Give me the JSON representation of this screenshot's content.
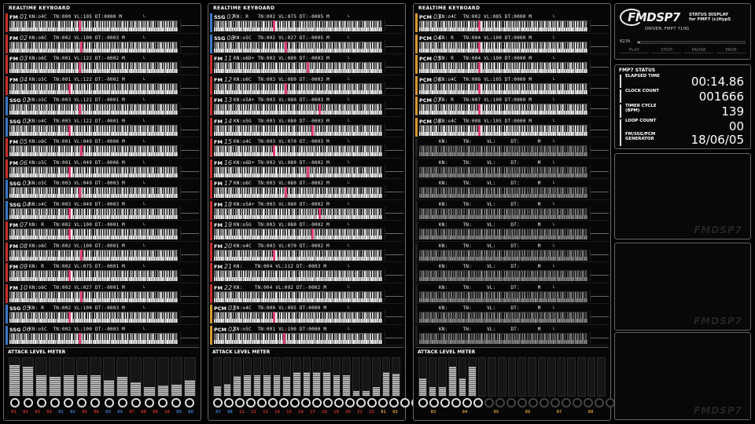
{
  "colors": {
    "fm": "#c8302c",
    "ssg": "#3a78c8",
    "pcm": "#d89830",
    "hit": "#e04070"
  },
  "panel_title": "REALTIME KEYBOARD",
  "meter_title": "ATTACK LEVEL METER",
  "scale_mark": "L",
  "panels": [
    {
      "tracks": [
        {
          "type": "fm",
          "label": "FM",
          "num": "01",
          "info": "KN:o4C  TN:000 VL:105 DT:0000 M",
          "hit": 0.41
        },
        {
          "type": "fm",
          "label": "FM",
          "num": "02",
          "info": "KN:o6C  TN:002 VL:100 DT:-0003 M",
          "hit": 0.42
        },
        {
          "type": "fm",
          "label": "FM",
          "num": "03",
          "info": "KN:o6C  TN:001 VL:122 DT:-0002 M",
          "hit": 0.41
        },
        {
          "type": "fm",
          "label": "FM",
          "num": "04",
          "info": "KN:o5C  TN:001 VL:122 DT:-0002 M",
          "hit": 0.35
        },
        {
          "type": "ssg",
          "label": "SSG",
          "num": "01",
          "info": "KN:o5C  TN:003 VL:122 DT:-0001 M",
          "hit": 0.41
        },
        {
          "type": "ssg",
          "label": "SSG",
          "num": "02",
          "info": "KN:o4C  TN:003 VL:122 DT:-0001 M",
          "hit": 0.35
        },
        {
          "type": "fm",
          "label": "FM",
          "num": "05",
          "info": "KN:o6C  TN:001 VL:049 DT:-0006 M",
          "hit": 0.42
        },
        {
          "type": "fm",
          "label": "FM",
          "num": "06",
          "info": "KN:o5C  TN:001 VL:049 DT:-0006 M",
          "hit": 0.35
        },
        {
          "type": "ssg",
          "label": "SSG",
          "num": "03",
          "info": "KN:o5C  TN:003 VL:049 DT:-0003 M",
          "hit": 0.41
        },
        {
          "type": "ssg",
          "label": "SSG",
          "num": "04",
          "info": "KN:o4C  TN:003 VL:049 DT:-0003 M",
          "hit": 0.35
        },
        {
          "type": "fm",
          "label": "FM",
          "num": "07",
          "info": "KN: R   TN:002 VL:100 DT:-0001 M",
          "hit": 0.35
        },
        {
          "type": "fm",
          "label": "FM",
          "num": "08",
          "info": "KN:o6C  TN:002 VL:100 DT:-0001 M",
          "hit": 0.42
        },
        {
          "type": "fm",
          "label": "FM",
          "num": "09",
          "info": "KN: R   TN:002 VL:075 DT:-0001 M",
          "hit": 0.35
        },
        {
          "type": "fm",
          "label": "FM",
          "num": "10",
          "info": "KN:o6C  TN:002 VL:027 DT:-0001 M",
          "hit": 0.42
        },
        {
          "type": "ssg",
          "label": "SSG",
          "num": "05",
          "info": "KN: R   TN:002 VL:100 DT:-0003 M",
          "hit": 0.35
        },
        {
          "type": "ssg",
          "label": "SSG",
          "num": "06",
          "info": "KN:o5C  TN:002 VL:100 DT:-0003 M",
          "hit": 0.41
        }
      ],
      "meter": {
        "levels": [
          0.82,
          0.78,
          0.55,
          0.5,
          0.55,
          0.55,
          0.55,
          0.42,
          0.5,
          0.35,
          0.22,
          0.28,
          0.3,
          0.42
        ],
        "labels": [
          {
            "c": "fm",
            "t": "01"
          },
          {
            "c": "fm",
            "t": "02"
          },
          {
            "c": "fm",
            "t": "03"
          },
          {
            "c": "fm",
            "t": "04"
          },
          {
            "c": "ssg",
            "t": "01"
          },
          {
            "c": "ssg",
            "t": "02"
          },
          {
            "c": "fm",
            "t": "05"
          },
          {
            "c": "fm",
            "t": "06"
          },
          {
            "c": "ssg",
            "t": "03"
          },
          {
            "c": "ssg",
            "t": "04"
          },
          {
            "c": "fm",
            "t": "07"
          },
          {
            "c": "fm",
            "t": "08"
          },
          {
            "c": "fm",
            "t": "09"
          },
          {
            "c": "fm",
            "t": "10"
          },
          {
            "c": "ssg",
            "t": "05"
          },
          {
            "c": "ssg",
            "t": "06"
          }
        ]
      }
    },
    {
      "tracks": [
        {
          "type": "ssg",
          "label": "SSG",
          "num": "07",
          "info": "KN: R   TN:002 VL:075 DT:-0005 M",
          "hit": 0.35
        },
        {
          "type": "ssg",
          "label": "SSG",
          "num": "08",
          "info": "KN:o5C  TN:002 VL:027 DT:-0005 M",
          "hit": 0.42
        },
        {
          "type": "fm",
          "label": "FM",
          "num": "11",
          "info": "KN:o6D+ TN:003 VL:080 DT:-0003 M",
          "hit": 0.55
        },
        {
          "type": "fm",
          "label": "FM",
          "num": "12",
          "info": "KN:o6C  TN:003 VL:080 DT:-0003 M",
          "hit": 0.42
        },
        {
          "type": "fm",
          "label": "FM",
          "num": "13",
          "info": "KN:o5A+ TN:003 VL:080 DT:-0003 M",
          "hit": 0.62
        },
        {
          "type": "fm",
          "label": "FM",
          "num": "14",
          "info": "KN:o5G  TN:003 VL:080 DT:-0003 M",
          "hit": 0.58
        },
        {
          "type": "fm",
          "label": "FM",
          "num": "15",
          "info": "KN:o4C  TN:003 VL:070 DT:-0003 M",
          "hit": 0.35
        },
        {
          "type": "fm",
          "label": "FM",
          "num": "16",
          "info": "KN:o6D+ TN:003 VL:080 DT:-0002 M",
          "hit": 0.55
        },
        {
          "type": "fm",
          "label": "FM",
          "num": "17",
          "info": "KN:o6C  TN:003 VL:080 DT:-0002 M",
          "hit": 0.42
        },
        {
          "type": "fm",
          "label": "FM",
          "num": "18",
          "info": "KN:o5A+ TN:003 VL:080 DT:-0002 M",
          "hit": 0.62
        },
        {
          "type": "fm",
          "label": "FM",
          "num": "19",
          "info": "KN:o5G  TN:003 VL:080 DT:-0002 M",
          "hit": 0.58
        },
        {
          "type": "fm",
          "label": "FM",
          "num": "20",
          "info": "KN:o4C  TN:003 VL:070 DT:-0002 M",
          "hit": 0.35
        },
        {
          "type": "fm",
          "label": "FM",
          "num": "21",
          "info": "KN:    TN:004 VL:112 DT:-0003 M",
          "hit": null
        },
        {
          "type": "fm",
          "label": "FM",
          "num": "22",
          "info": "KN:    TN:004 VL:092 DT:-0002 M",
          "hit": null
        },
        {
          "type": "pcm",
          "label": "PCM",
          "num": "01",
          "info": "KN:o4C  TN:000 VL:095 DT:0000 M",
          "hit": 0.35
        },
        {
          "type": "pcm",
          "label": "PCM",
          "num": "02",
          "info": "KN:o5C  TN:001 VL:100 DT:0000 M",
          "hit": 0.41
        }
      ],
      "meter": {
        "levels": [
          0.25,
          0.32,
          0.52,
          0.55,
          0.55,
          0.55,
          0.55,
          0.5,
          0.62,
          0.62,
          0.62,
          0.62,
          0.55,
          0.55,
          0.12,
          0.12,
          0.22,
          0.62,
          0.58
        ],
        "labels": [
          {
            "c": "ssg",
            "t": "07"
          },
          {
            "c": "ssg",
            "t": "08"
          },
          {
            "c": "fm",
            "t": "11"
          },
          {
            "c": "fm",
            "t": "12"
          },
          {
            "c": "fm",
            "t": "13"
          },
          {
            "c": "fm",
            "t": "14"
          },
          {
            "c": "fm",
            "t": "15"
          },
          {
            "c": "fm",
            "t": "16"
          },
          {
            "c": "fm",
            "t": "17"
          },
          {
            "c": "fm",
            "t": "18"
          },
          {
            "c": "fm",
            "t": "19"
          },
          {
            "c": "fm",
            "t": "20"
          },
          {
            "c": "fm",
            "t": "21"
          },
          {
            "c": "fm",
            "t": "22"
          },
          {
            "c": "pcm",
            "t": "01"
          },
          {
            "c": "pcm",
            "t": "02"
          }
        ]
      }
    },
    {
      "tracks": [
        {
          "type": "pcm",
          "label": "PCM",
          "num": "03",
          "info": "KN:o4C  TN:002 VL:085 DT:0000 M",
          "hit": 0.35
        },
        {
          "type": "pcm",
          "label": "PCM",
          "num": "04",
          "info": "KN: R   TN:004 VL:100 DT:0000 M",
          "hit": 0.35
        },
        {
          "type": "pcm",
          "label": "PCM",
          "num": "05",
          "info": "KN: R   TN:004 VL:100 DT:0000 M",
          "hit": 0.35
        },
        {
          "type": "pcm",
          "label": "PCM",
          "num": "06",
          "info": "KN:o4C  TN:006 VL:105 DT:0000 M",
          "hit": 0.35
        },
        {
          "type": "pcm",
          "label": "PCM",
          "num": "07",
          "info": "KN: R   TN:007 VL:100 DT:0000 M",
          "hit": 0.35
        },
        {
          "type": "pcm",
          "label": "PCM",
          "num": "08",
          "info": "KN:o4C  TN:008 VL:105 DT:0000 M",
          "hit": 0.35
        },
        {
          "type": "off",
          "label": "",
          "num": "",
          "info": "KN:     TN:     VL:     DT:      M",
          "hit": null
        },
        {
          "type": "off",
          "label": "",
          "num": "",
          "info": "KN:     TN:     VL:     DT:      M",
          "hit": null
        },
        {
          "type": "off",
          "label": "",
          "num": "",
          "info": "KN:     TN:     VL:     DT:      M",
          "hit": null
        },
        {
          "type": "off",
          "label": "",
          "num": "",
          "info": "KN:     TN:     VL:     DT:      M",
          "hit": null
        },
        {
          "type": "off",
          "label": "",
          "num": "",
          "info": "KN:     TN:     VL:     DT:      M",
          "hit": null
        },
        {
          "type": "off",
          "label": "",
          "num": "",
          "info": "KN:     TN:     VL:     DT:      M",
          "hit": null
        },
        {
          "type": "off",
          "label": "",
          "num": "",
          "info": "KN:     TN:     VL:     DT:      M",
          "hit": null
        },
        {
          "type": "off",
          "label": "",
          "num": "",
          "info": "KN:     TN:     VL:     DT:      M",
          "hit": null
        },
        {
          "type": "off",
          "label": "",
          "num": "",
          "info": "KN:     TN:     VL:     DT:      M",
          "hit": null
        },
        {
          "type": "off",
          "label": "",
          "num": "",
          "info": "KN:     TN:     VL:     DT:      M",
          "hit": null
        }
      ],
      "meter": {
        "levels": [
          0.45,
          0.22,
          0.22,
          0.78,
          0.45,
          0.78,
          0,
          0,
          0,
          0,
          0,
          0,
          0,
          0,
          0,
          0,
          0,
          0,
          0
        ],
        "labels": [
          {
            "c": "pcm",
            "t": "03"
          },
          {
            "c": "pcm",
            "t": "04"
          },
          {
            "c": "pcm",
            "t": "05"
          },
          {
            "c": "pcm",
            "t": "06"
          },
          {
            "c": "pcm",
            "t": "07"
          },
          {
            "c": "pcm",
            "t": "08"
          }
        ]
      }
    }
  ],
  "logo": {
    "title": "FMDSP7",
    "sub_line1": "STATUS DISPLAY",
    "sub_line2": "for FMP7 (c)HypS",
    "driver": "DRIVER: FMP7 710G"
  },
  "progress": {
    "percent_text": "023%",
    "fraction": 0.023
  },
  "controls": [
    "PLAY",
    "STOP",
    "PAUSE",
    "FADE"
  ],
  "status": {
    "title": "FMP7 STATUS",
    "rows": [
      {
        "label": "ELAPSED TIME",
        "value": "00:14.86"
      },
      {
        "label": "CLOCK COUNT",
        "value": "001666"
      },
      {
        "label": "TIMER CYCLE\n(BPM)",
        "value": "139"
      },
      {
        "label": "LOOP COUNT",
        "value": "00"
      },
      {
        "label": "FM/SSG/PCM\nGENERATOR",
        "value": "18/06/05"
      }
    ]
  },
  "watermark": "FMDSP7"
}
